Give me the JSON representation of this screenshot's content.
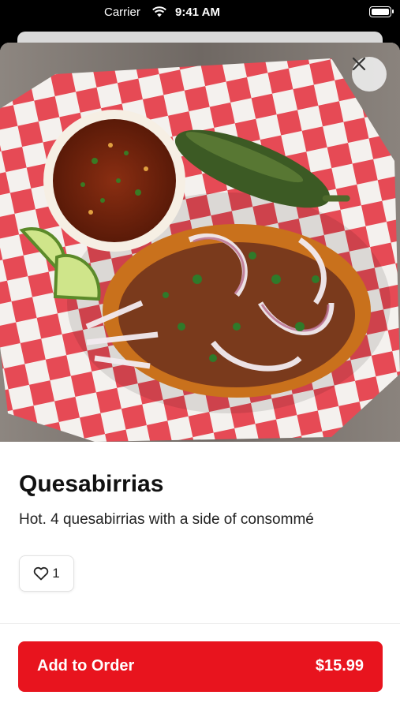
{
  "status_bar": {
    "carrier": "Carrier",
    "time": "9:41 AM"
  },
  "item": {
    "title": "Quesabirrias",
    "description": "Hot. 4 quesabirrias with a side of consommé",
    "likes": "1"
  },
  "order_button": {
    "label": "Add to Order",
    "price": "$15.99"
  },
  "colors": {
    "accent": "#e8141e",
    "checker_red": "#e64a55"
  },
  "icons": {
    "close": "close-icon",
    "like": "heart-icon",
    "wifi": "wifi-icon",
    "battery": "battery-icon"
  }
}
